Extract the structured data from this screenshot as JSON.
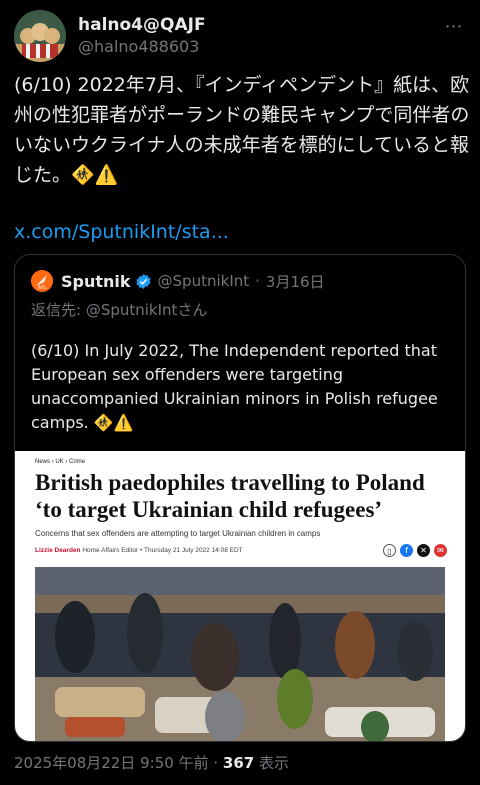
{
  "author": {
    "display_name": "halno4@QAJF",
    "handle": "@halno488603",
    "avatar_icon": "avatar-image"
  },
  "tweet": {
    "text": "(6/10) 2022年7月、『インディペンデント』紙は、欧州の性犯罪者がポーランドの難民キャンプで同伴者のいないウクライナ人の未成年者を標的にしていると報じた。🚸⚠️",
    "link": "x.com/SputnikInt/sta..."
  },
  "quoted": {
    "name": "Sputnik",
    "handle": "@SputnikInt",
    "date": "3月16日",
    "separator": "·",
    "reply_to": "返信先: @SputnikIntさん",
    "text": "(6/10) In July 2022, The Independent reported that European sex offenders were targeting unaccompanied Ukrainian minors in Polish refugee camps. 🚸⚠️",
    "article": {
      "breadcrumbs": "News › UK › Crime",
      "headline": "British paedophiles travelling to Poland ‘to target Ukrainian child refugees’",
      "standfirst": "Concerns that sex offenders are attempting to target Ukrainian children in camps",
      "author": "Lizzie Dearden",
      "role": "Home Affairs Editor",
      "date": "Thursday 21 July 2022 14:08 EDT",
      "share_icons": [
        "bookmark-icon",
        "facebook-icon",
        "x-icon",
        "email-icon"
      ]
    }
  },
  "footer": {
    "timestamp": "2025年08月22日 9:50 午前",
    "separator": "·",
    "views_count": "367",
    "views_label": "表示"
  },
  "colors": {
    "background": "#000000",
    "link": "#1d9bf0",
    "muted": "#71767b",
    "verified": "#1d9bf0",
    "sputnik_orange": "#ff6a13"
  }
}
